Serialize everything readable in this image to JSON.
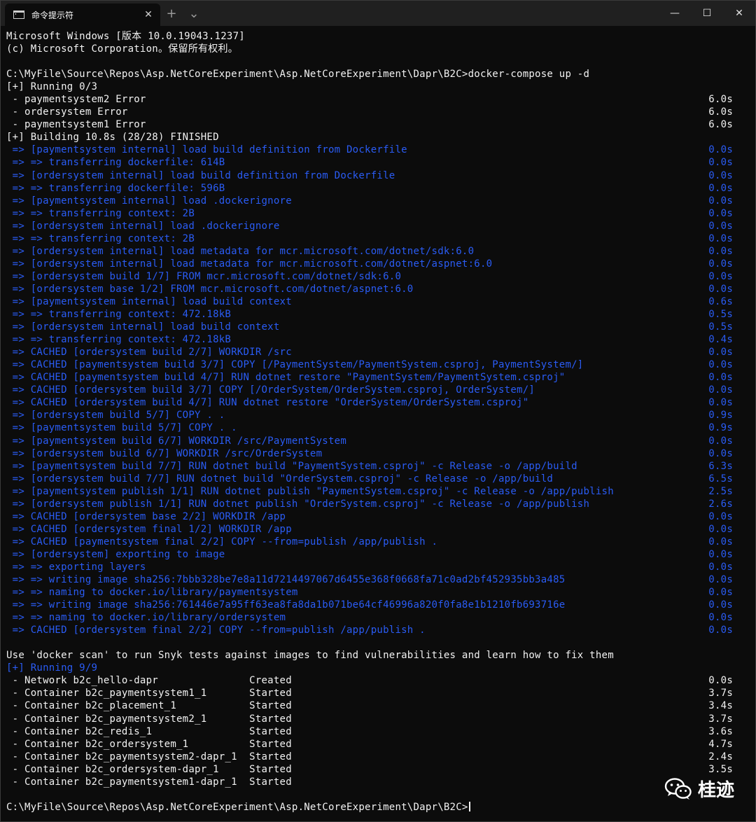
{
  "window": {
    "tab_title": "命令提示符",
    "tab_close": "✕",
    "new_tab": "+",
    "dropdown": "⌄",
    "minimize": "—",
    "maximize": "☐",
    "close": "✕"
  },
  "colors": {
    "background": "#0c0c0c",
    "text": "#f2f2f2",
    "build_text": "#2a5cf5"
  },
  "console": {
    "lines": [
      {
        "text": "Microsoft Windows [版本 10.0.19043.1237]",
        "time": "",
        "color": "w"
      },
      {
        "text": "(c) Microsoft Corporation。保留所有权利。",
        "time": "",
        "color": "w"
      },
      {
        "text": "",
        "time": "",
        "color": "w"
      },
      {
        "text": "C:\\MyFile\\Source\\Repos\\Asp.NetCoreExperiment\\Asp.NetCoreExperiment\\Dapr\\B2C>docker-compose up -d",
        "time": "",
        "color": "w"
      },
      {
        "text": "[+] Running 0/3",
        "time": "",
        "color": "w"
      },
      {
        "text": " - paymentsystem2 Error",
        "time": "6.0s",
        "color": "w"
      },
      {
        "text": " - ordersystem Error",
        "time": "6.0s",
        "color": "w"
      },
      {
        "text": " - paymentsystem1 Error",
        "time": "6.0s",
        "color": "w"
      },
      {
        "text": "[+] Building 10.8s (28/28) FINISHED",
        "time": "",
        "color": "w"
      },
      {
        "text": " => [paymentsystem internal] load build definition from Dockerfile",
        "time": "0.0s",
        "color": "b"
      },
      {
        "text": " => => transferring dockerfile: 614B",
        "time": "0.0s",
        "color": "b"
      },
      {
        "text": " => [ordersystem internal] load build definition from Dockerfile",
        "time": "0.0s",
        "color": "b"
      },
      {
        "text": " => => transferring dockerfile: 596B",
        "time": "0.0s",
        "color": "b"
      },
      {
        "text": " => [paymentsystem internal] load .dockerignore",
        "time": "0.0s",
        "color": "b"
      },
      {
        "text": " => => transferring context: 2B",
        "time": "0.0s",
        "color": "b"
      },
      {
        "text": " => [ordersystem internal] load .dockerignore",
        "time": "0.0s",
        "color": "b"
      },
      {
        "text": " => => transferring context: 2B",
        "time": "0.0s",
        "color": "b"
      },
      {
        "text": " => [ordersystem internal] load metadata for mcr.microsoft.com/dotnet/sdk:6.0",
        "time": "0.0s",
        "color": "b"
      },
      {
        "text": " => [ordersystem internal] load metadata for mcr.microsoft.com/dotnet/aspnet:6.0",
        "time": "0.0s",
        "color": "b"
      },
      {
        "text": " => [ordersystem build 1/7] FROM mcr.microsoft.com/dotnet/sdk:6.0",
        "time": "0.0s",
        "color": "b"
      },
      {
        "text": " => [ordersystem base 1/2] FROM mcr.microsoft.com/dotnet/aspnet:6.0",
        "time": "0.0s",
        "color": "b"
      },
      {
        "text": " => [paymentsystem internal] load build context",
        "time": "0.6s",
        "color": "b"
      },
      {
        "text": " => => transferring context: 472.18kB",
        "time": "0.5s",
        "color": "b"
      },
      {
        "text": " => [ordersystem internal] load build context",
        "time": "0.5s",
        "color": "b"
      },
      {
        "text": " => => transferring context: 472.18kB",
        "time": "0.4s",
        "color": "b"
      },
      {
        "text": " => CACHED [ordersystem build 2/7] WORKDIR /src",
        "time": "0.0s",
        "color": "b"
      },
      {
        "text": " => CACHED [paymentsystem build 3/7] COPY [/PaymentSystem/PaymentSystem.csproj, PaymentSystem/]",
        "time": "0.0s",
        "color": "b"
      },
      {
        "text": " => CACHED [paymentsystem build 4/7] RUN dotnet restore \"PaymentSystem/PaymentSystem.csproj\"",
        "time": "0.0s",
        "color": "b"
      },
      {
        "text": " => CACHED [ordersystem build 3/7] COPY [/OrderSystem/OrderSystem.csproj, OrderSystem/]",
        "time": "0.0s",
        "color": "b"
      },
      {
        "text": " => CACHED [ordersystem build 4/7] RUN dotnet restore \"OrderSystem/OrderSystem.csproj\"",
        "time": "0.0s",
        "color": "b"
      },
      {
        "text": " => [ordersystem build 5/7] COPY . .",
        "time": "0.9s",
        "color": "b"
      },
      {
        "text": " => [paymentsystem build 5/7] COPY . .",
        "time": "0.9s",
        "color": "b"
      },
      {
        "text": " => [paymentsystem build 6/7] WORKDIR /src/PaymentSystem",
        "time": "0.0s",
        "color": "b"
      },
      {
        "text": " => [ordersystem build 6/7] WORKDIR /src/OrderSystem",
        "time": "0.0s",
        "color": "b"
      },
      {
        "text": " => [paymentsystem build 7/7] RUN dotnet build \"PaymentSystem.csproj\" -c Release -o /app/build",
        "time": "6.3s",
        "color": "b"
      },
      {
        "text": " => [ordersystem build 7/7] RUN dotnet build \"OrderSystem.csproj\" -c Release -o /app/build",
        "time": "6.5s",
        "color": "b"
      },
      {
        "text": " => [paymentsystem publish 1/1] RUN dotnet publish \"PaymentSystem.csproj\" -c Release -o /app/publish",
        "time": "2.5s",
        "color": "b"
      },
      {
        "text": " => [ordersystem publish 1/1] RUN dotnet publish \"OrderSystem.csproj\" -c Release -o /app/publish",
        "time": "2.6s",
        "color": "b"
      },
      {
        "text": " => CACHED [ordersystem base 2/2] WORKDIR /app",
        "time": "0.0s",
        "color": "b"
      },
      {
        "text": " => CACHED [ordersystem final 1/2] WORKDIR /app",
        "time": "0.0s",
        "color": "b"
      },
      {
        "text": " => CACHED [paymentsystem final 2/2] COPY --from=publish /app/publish .",
        "time": "0.0s",
        "color": "b"
      },
      {
        "text": " => [ordersystem] exporting to image",
        "time": "0.0s",
        "color": "b"
      },
      {
        "text": " => => exporting layers",
        "time": "0.0s",
        "color": "b"
      },
      {
        "text": " => => writing image sha256:7bbb328be7e8a11d7214497067d6455e368f0668fa71c0ad2bf452935bb3a485",
        "time": "0.0s",
        "color": "b"
      },
      {
        "text": " => => naming to docker.io/library/paymentsystem",
        "time": "0.0s",
        "color": "b"
      },
      {
        "text": " => => writing image sha256:761446e7a95ff63ea8fa8da1b071be64cf46996a820f0fa8e1b1210fb693716e",
        "time": "0.0s",
        "color": "b"
      },
      {
        "text": " => => naming to docker.io/library/ordersystem",
        "time": "0.0s",
        "color": "b"
      },
      {
        "text": " => CACHED [ordersystem final 2/2] COPY --from=publish /app/publish .",
        "time": "0.0s",
        "color": "b"
      },
      {
        "text": "",
        "time": "",
        "color": "w"
      },
      {
        "text": "Use 'docker scan' to run Snyk tests against images to find vulnerabilities and learn how to fix them",
        "time": "",
        "color": "w"
      },
      {
        "text": "[+] Running 9/9",
        "time": "",
        "color": "b"
      },
      {
        "text": " - Network b2c_hello-dapr               Created",
        "time": "0.0s",
        "color": "w"
      },
      {
        "text": " - Container b2c_paymentsystem1_1       Started",
        "time": "3.7s",
        "color": "w"
      },
      {
        "text": " - Container b2c_placement_1            Started",
        "time": "3.4s",
        "color": "w"
      },
      {
        "text": " - Container b2c_paymentsystem2_1       Started",
        "time": "3.7s",
        "color": "w"
      },
      {
        "text": " - Container b2c_redis_1                Started",
        "time": "3.6s",
        "color": "w"
      },
      {
        "text": " - Container b2c_ordersystem_1          Started",
        "time": "4.7s",
        "color": "w"
      },
      {
        "text": " - Container b2c_paymentsystem2-dapr_1  Started",
        "time": "2.4s",
        "color": "w"
      },
      {
        "text": " - Container b2c_ordersystem-dapr_1     Started",
        "time": "3.5s",
        "color": "w"
      },
      {
        "text": " - Container b2c_paymentsystem1-dapr_1  Started",
        "time": "",
        "color": "w"
      },
      {
        "text": "",
        "time": "",
        "color": "w"
      }
    ],
    "prompt": "C:\\MyFile\\Source\\Repos\\Asp.NetCoreExperiment\\Asp.NetCoreExperiment\\Dapr\\B2C>"
  },
  "watermark": {
    "text": "桂迹",
    "icon": "wechat-icon"
  }
}
